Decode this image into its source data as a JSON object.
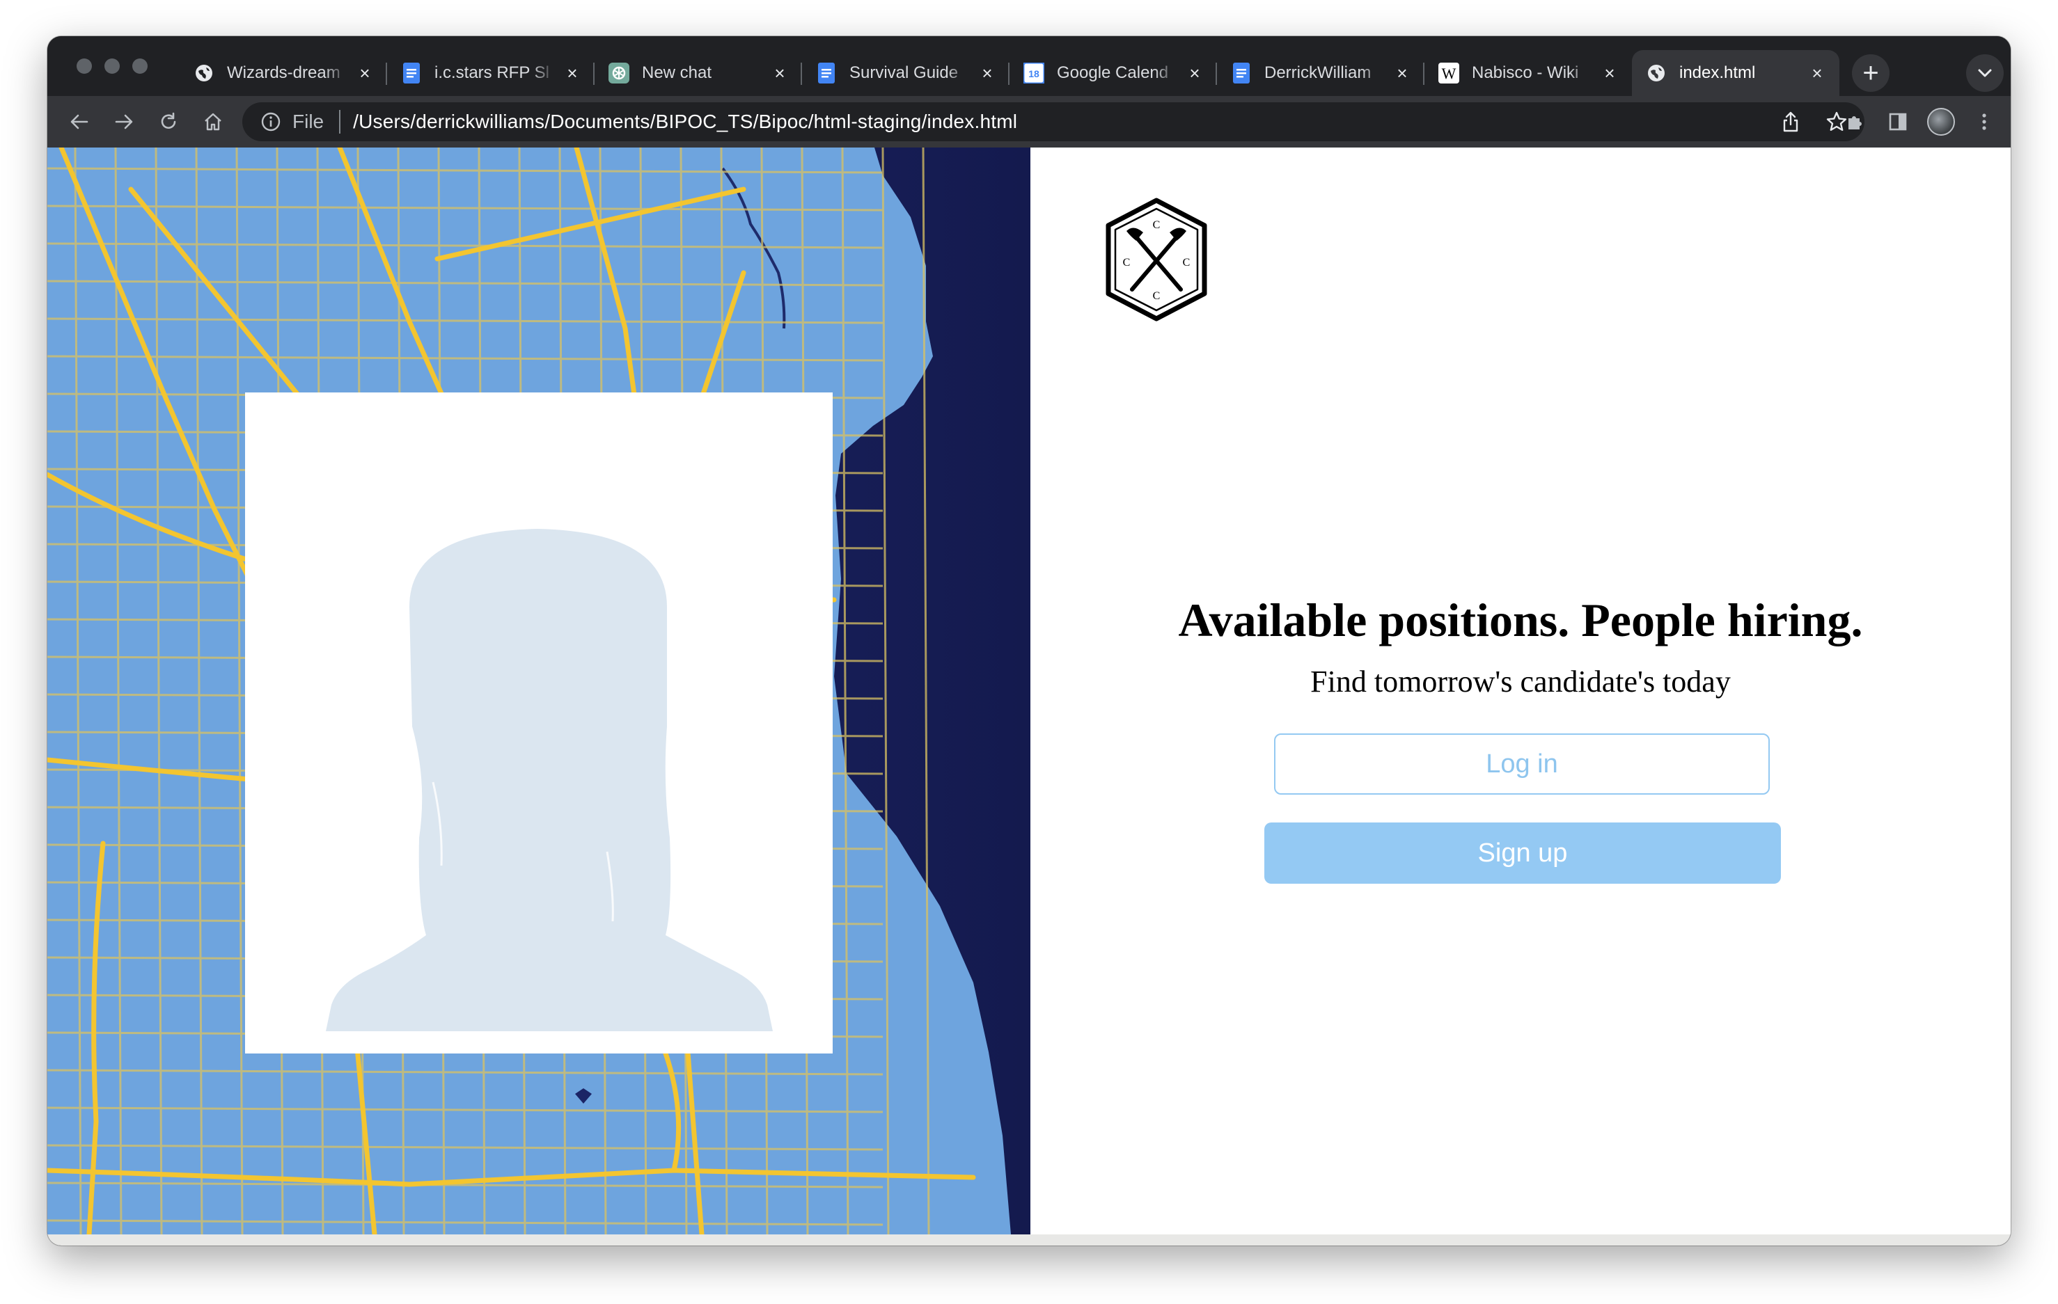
{
  "browser": {
    "tabs": [
      {
        "title": "Wizards-dream",
        "favicon": "globe-icon"
      },
      {
        "title": "i.c.stars RFP Sl",
        "favicon": "docs-icon"
      },
      {
        "title": "New chat",
        "favicon": "openai-icon"
      },
      {
        "title": "Survival Guide",
        "favicon": "docs-icon"
      },
      {
        "title": "Google Calend",
        "favicon": "calendar-icon",
        "favicon_text": "18"
      },
      {
        "title": "DerrickWilliam",
        "favicon": "docs-icon"
      },
      {
        "title": "Nabisco - Wiki",
        "favicon": "wikipedia-icon",
        "favicon_text": "W"
      },
      {
        "title": "index.html",
        "favicon": "globe-icon",
        "active": true
      }
    ],
    "address_bar": {
      "scheme_label": "File",
      "url": "/Users/derrickwilliams/Documents/BIPOC_TS/Bipoc/html-staging/index.html"
    },
    "colors": {
      "frame": "#202124",
      "toolbar": "#35363a",
      "docs_blue": "#4285f4"
    }
  },
  "page": {
    "logo": {
      "letters": [
        "C",
        "C",
        "C",
        "C"
      ],
      "icon": "crossed-axes-logo-icon"
    },
    "hero": {
      "headline": "Available positions. People hiring.",
      "subheadline": "Find tomorrow's candidate's today"
    },
    "actions": {
      "login_label": "Log in",
      "signup_label": "Sign up"
    },
    "images": {
      "map": "city-street-map-image",
      "profile": "profile-placeholder-silhouette"
    },
    "colors": {
      "map_water": "#1b1f5c",
      "map_land": "#6fa5e0",
      "map_roads": "#f2c230",
      "button_blue": "#94c9f3",
      "silhouette": "#dbe6f0"
    }
  }
}
